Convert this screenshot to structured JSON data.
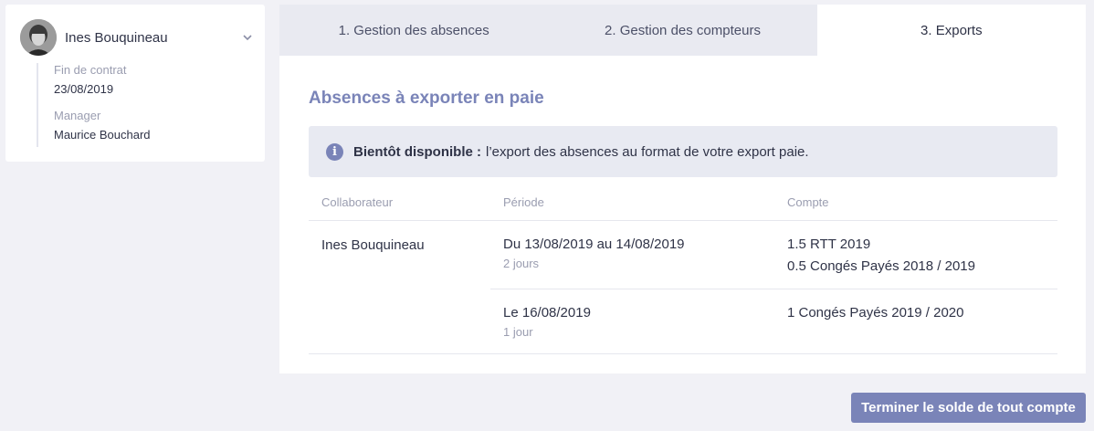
{
  "employee": {
    "name": "Ines Bouquineau",
    "details": [
      {
        "label": "Fin de contrat",
        "value": "23/08/2019"
      },
      {
        "label": "Manager",
        "value": "Maurice Bouchard"
      }
    ]
  },
  "tabs": [
    {
      "label": "1. Gestion des absences",
      "active": false
    },
    {
      "label": "2. Gestion des compteurs",
      "active": false
    },
    {
      "label": "3. Exports",
      "active": true
    }
  ],
  "section": {
    "title": "Absences à exporter en paie",
    "info_strong": "Bientôt disponible :",
    "info_text": "l’export des absences au format de votre export paie.",
    "info_icon": "info-icon"
  },
  "table": {
    "headers": [
      "Collaborateur",
      "Période",
      "Compte"
    ],
    "rows": [
      {
        "collaborator": "Ines Bouquineau",
        "periods": [
          {
            "period": "Du 13/08/2019 au 14/08/2019",
            "duration": "2 jours",
            "accounts": [
              "1.5 RTT 2019",
              "0.5 Congés Payés 2018 / 2019"
            ]
          },
          {
            "period": "Le 16/08/2019",
            "duration": "1 jour",
            "accounts": [
              "1 Congés Payés 2019 / 2020"
            ]
          }
        ]
      }
    ]
  },
  "footer": {
    "button_label": "Terminer le solde de tout compte"
  },
  "colors": {
    "accent": "#7a84b8",
    "background": "#f1f1f6",
    "tab_inactive": "#e9eaf1"
  }
}
